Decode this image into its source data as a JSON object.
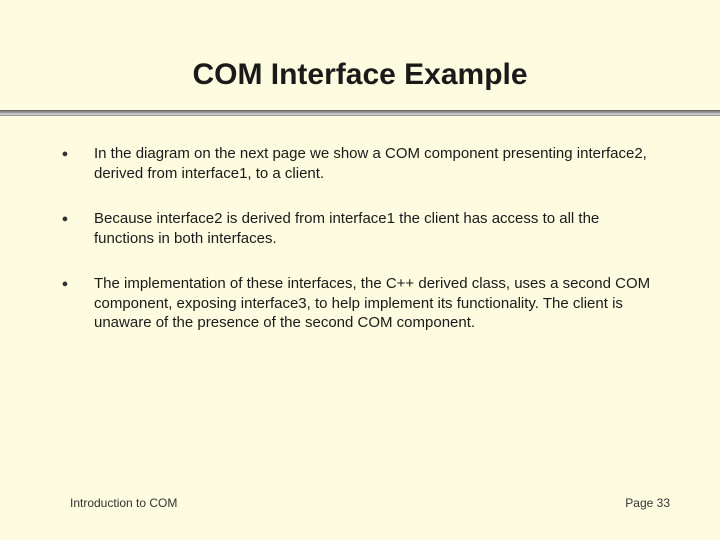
{
  "title": "COM Interface Example",
  "bullets": [
    "In the diagram on the next page we show a COM component presenting interface2, derived from interface1, to a client.",
    "Because interface2 is derived from interface1 the client has access to all the functions in both interfaces.",
    "The implementation of these interfaces, the C++ derived class, uses a second COM component, exposing interface3, to help implement its functionality.  The client is unaware of the presence of the second COM component."
  ],
  "footer": {
    "left": "Introduction to COM",
    "right": "Page 33"
  }
}
